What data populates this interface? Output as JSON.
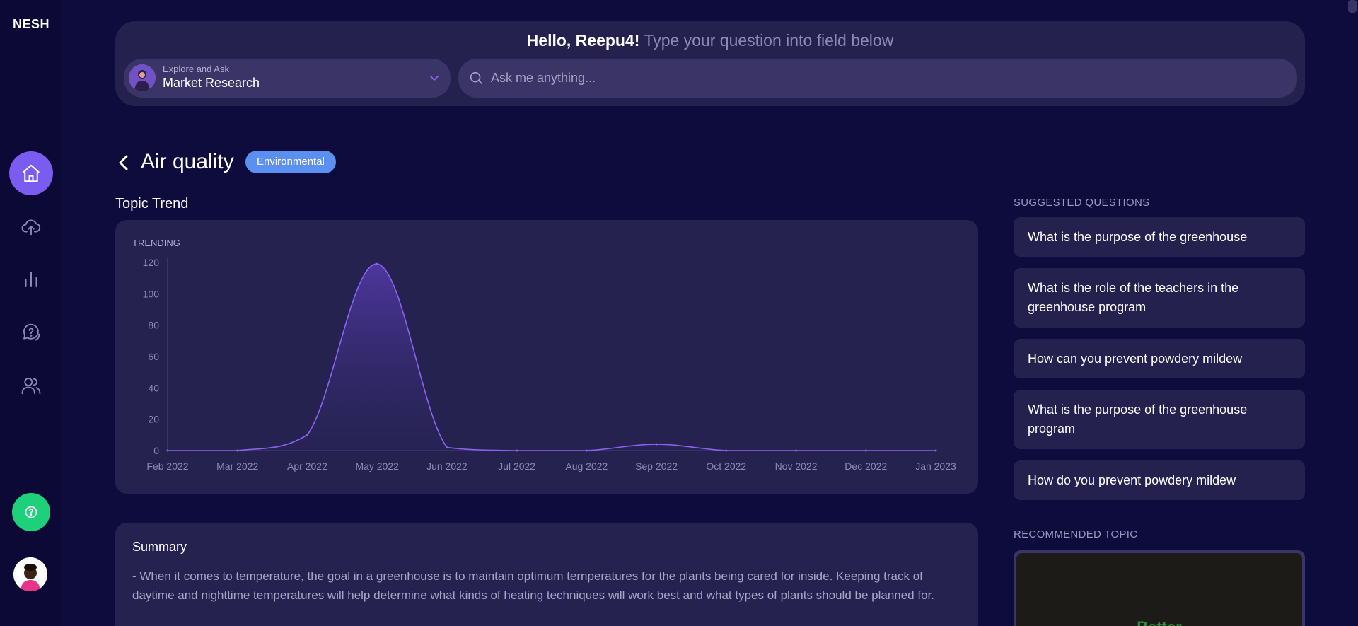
{
  "app": {
    "logo": "NESH"
  },
  "sidebar": {
    "items": [
      {
        "icon": "home-icon",
        "active": true
      },
      {
        "icon": "upload-cloud-icon",
        "active": false
      },
      {
        "icon": "bar-chart-icon",
        "active": false
      },
      {
        "icon": "chat-question-icon",
        "active": false
      },
      {
        "icon": "users-icon",
        "active": false
      }
    ],
    "help_icon": "help-circle-icon",
    "accent": "#7b5cf0",
    "help_color": "#1ed07a"
  },
  "header": {
    "greeting": "Hello, Reepu4!",
    "subtext": "Type your question into field below",
    "topic_label_small": "Explore and Ask",
    "topic_value": "Market Research",
    "search_placeholder": "Ask me anything..."
  },
  "page": {
    "title": "Air quality",
    "badge": "Environmental",
    "badge_color": "#5b8ff0",
    "chart_section_title": "Topic Trend"
  },
  "chart_data": {
    "type": "area",
    "series_label": "TRENDING",
    "x": [
      "Feb 2022",
      "Mar 2022",
      "Apr 2022",
      "May 2022",
      "Jun 2022",
      "Jul 2022",
      "Aug 2022",
      "Sep 2022",
      "Oct 2022",
      "Nov 2022",
      "Dec 2022",
      "Jan 2023"
    ],
    "values": [
      0,
      0,
      10,
      119,
      2,
      0,
      0,
      4,
      0,
      0,
      0,
      0
    ],
    "yticks": [
      0,
      20,
      40,
      60,
      80,
      100,
      120
    ],
    "ylim": [
      0,
      120
    ],
    "line_color": "#8a63f2"
  },
  "summary": {
    "title": "Summary",
    "text": "- When it comes to temperature, the goal in a greenhouse is to maintain optimum ternperatures for the plants being cared for inside. Keeping track of daytime and nighttime temperatures will help determine what kinds of heating techniques will work best and what types of plants should be planned for."
  },
  "suggested": {
    "heading": "SUGGESTED QUESTIONS",
    "questions": [
      "What is the purpose of the greenhouse",
      "What is the role of the teachers in the greenhouse program",
      "How can you prevent powdery mildew",
      "What is the purpose of the greenhouse program",
      "How do you prevent powdery mildew"
    ]
  },
  "recommended": {
    "heading": "RECOMMENDED TOPIC",
    "image_text": "Better"
  }
}
